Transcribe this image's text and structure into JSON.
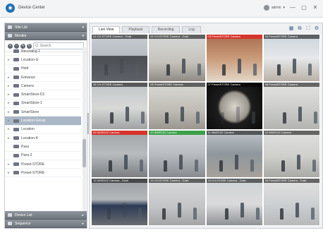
{
  "app": {
    "title": "Device Center",
    "user": "admin"
  },
  "window_controls": {
    "minimize": "—",
    "restore": "▢",
    "close": "✕"
  },
  "sidebar": {
    "site_header": "Site List",
    "monitor_header": "Monitor",
    "search_placeholder": "Q. Search",
    "tree": [
      {
        "label": "Recording 1",
        "indent": 0,
        "expand": "",
        "selected": false
      },
      {
        "label": "Location-G",
        "indent": 0,
        "expand": "▸",
        "selected": false
      },
      {
        "label": "Hold",
        "indent": 0,
        "expand": "",
        "selected": false
      },
      {
        "label": "Entrance",
        "indent": 0,
        "expand": "▸",
        "selected": false
      },
      {
        "label": "Camera",
        "indent": 0,
        "expand": "▸",
        "selected": false
      },
      {
        "label": "SmartStore-D1",
        "indent": 0,
        "expand": "▸",
        "selected": false
      },
      {
        "label": "SmartStore-1",
        "indent": 0,
        "expand": "▸",
        "selected": false
      },
      {
        "label": "SmartStore",
        "indent": 0,
        "expand": "▸",
        "selected": false
      },
      {
        "label": "Location-Group",
        "indent": 0,
        "expand": "▸",
        "selected": true
      },
      {
        "label": "Location",
        "indent": 0,
        "expand": "▸",
        "selected": false
      },
      {
        "label": "Location-K",
        "indent": 0,
        "expand": "▸",
        "selected": false
      },
      {
        "label": "Pass",
        "indent": 0,
        "expand": "",
        "selected": false
      },
      {
        "label": "Pass-2",
        "indent": 0,
        "expand": "",
        "selected": false
      },
      {
        "label": "Preset-STORE",
        "indent": 0,
        "expand": "▸",
        "selected": false
      },
      {
        "label": "Preset-STORE",
        "indent": 0,
        "expand": "▸",
        "selected": false
      }
    ],
    "bottom_sections": [
      {
        "label": "Device List"
      },
      {
        "label": "Sequence"
      }
    ]
  },
  "main": {
    "tabs": [
      {
        "label": "Live View",
        "active": true
      },
      {
        "label": "Playback",
        "active": false
      },
      {
        "label": "Recording",
        "active": false
      },
      {
        "label": "Log",
        "active": false
      }
    ],
    "toolbar_icons": [
      "layout-icon",
      "sequence-icon",
      "fullscreen-icon",
      "settings-icon"
    ],
    "tiles": [
      {
        "caption": "01 CH-STORE Camera - Grab",
        "status": "normal",
        "scene": "street"
      },
      {
        "caption": "02 CH-STORE Camera - Grab",
        "status": "normal",
        "scene": "office-lobby"
      },
      {
        "caption": "03 PresetSTORE Camera",
        "status": "alert",
        "scene": "warehouse-workers"
      },
      {
        "caption": "04 PresetSTORE Camera",
        "status": "normal",
        "scene": "meeting-room"
      },
      {
        "caption": "05 CH-STORE Camera",
        "status": "normal",
        "scene": "hallway-people"
      },
      {
        "caption": "06 PresetSTORE Camera",
        "status": "normal",
        "scene": "walking"
      },
      {
        "caption": "07 PresetSTORE Camera",
        "status": "normal",
        "scene": "fisheye"
      },
      {
        "caption": "08 PresetSTORE Camera",
        "status": "normal",
        "scene": "office-desks"
      },
      {
        "caption": "09 WMS102 Camera",
        "status": "alert",
        "scene": "parking-garage"
      },
      {
        "caption": "10 WMS102 Camera",
        "status": "ok",
        "scene": "station"
      },
      {
        "caption": "11 WMS102 Camera",
        "status": "normal",
        "scene": "warehouse-aisle"
      },
      {
        "caption": "12 WMS102 Camera",
        "status": "normal",
        "scene": "office-walk"
      },
      {
        "caption": "13 WMS102 Camera - Grab",
        "status": "normal",
        "scene": "car-garage"
      },
      {
        "caption": "14 CH-STORE Camera - Grab",
        "status": "normal",
        "scene": "delivery"
      },
      {
        "caption": "15 CH-STORE Camera - Grab",
        "status": "normal",
        "scene": "team"
      },
      {
        "caption": "16 PresetSTORE Camera - Grab",
        "status": "normal",
        "scene": "meeting"
      }
    ]
  }
}
